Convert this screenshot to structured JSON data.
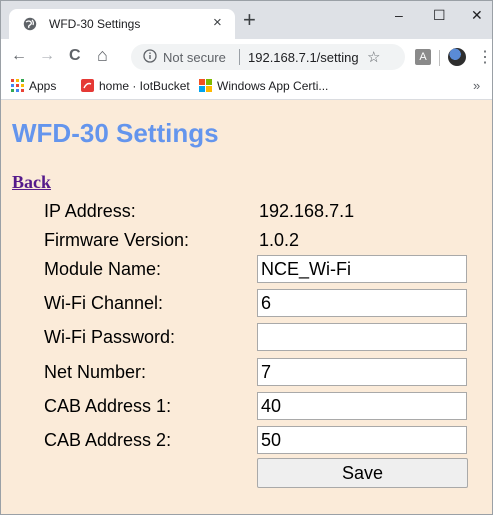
{
  "browser": {
    "tab_title": "WFD-30 Settings",
    "tab_close": "×",
    "new_tab": "+",
    "controls": {
      "minimize": "–",
      "maximize": "☐",
      "close": "✕"
    },
    "nav": {
      "back": "←",
      "forward": "→",
      "reload": "C",
      "home": "⌂"
    },
    "security_label": "Not secure",
    "url": "192.168.7.1/setting",
    "bookmarks": [
      {
        "label": "Apps",
        "icon": "apps-grid-icon"
      },
      {
        "label": "home · IotBucket",
        "icon": "iotbucket-icon"
      },
      {
        "label": "Windows App Certi...",
        "icon": "windows-logo-icon"
      }
    ],
    "bookmarks_more": "»",
    "pdf_ext_label": "A",
    "menu": "⋮"
  },
  "page": {
    "title": "WFD-30 Settings",
    "back_link": "Back",
    "ip_label": "IP Address:",
    "ip_value": "192.168.7.1",
    "firmware_label": "Firmware Version:",
    "firmware_value": "1.0.2",
    "module_name_label": "Module Name:",
    "module_name_value": "NCE_Wi-Fi",
    "channel_label": "Wi-Fi Channel:",
    "channel_value": "6",
    "password_label": "Wi-Fi Password:",
    "password_value": "",
    "net_label": "Net Number:",
    "net_value": "7",
    "cab1_label": "CAB Address 1:",
    "cab1_value": "40",
    "cab2_label": "CAB Address 2:",
    "cab2_value": "50",
    "save_label": "Save"
  },
  "colors": {
    "page_background": "#fbebd9",
    "title": "#6495ed",
    "link": "#551a8b"
  }
}
